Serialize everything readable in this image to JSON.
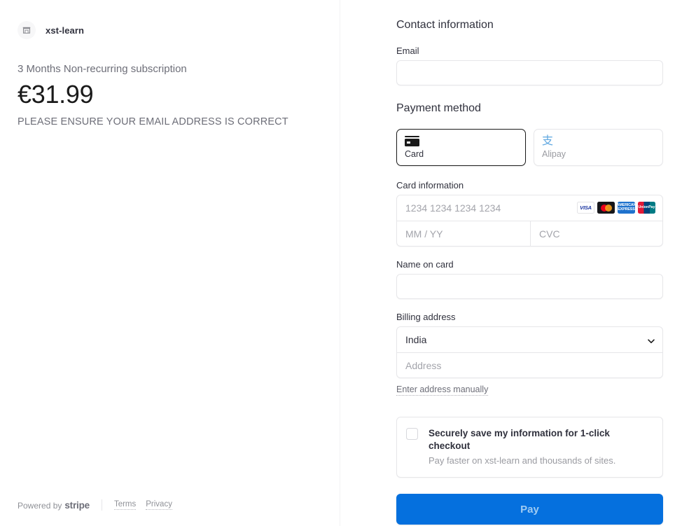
{
  "merchant": {
    "icon": "storefront-icon",
    "name": "xst-learn"
  },
  "summary": {
    "product": "3 Months Non-recurring subscription",
    "price": "€31.99",
    "notice": "PLEASE ENSURE YOUR EMAIL ADDRESS IS CORRECT"
  },
  "footer": {
    "powered_by": "Powered by",
    "stripe": "stripe",
    "terms": "Terms",
    "privacy": "Privacy"
  },
  "contact": {
    "section_title": "Contact information",
    "email_label": "Email",
    "email_value": "",
    "email_placeholder": ""
  },
  "payment_method": {
    "section_title": "Payment method",
    "tabs": [
      {
        "label": "Card",
        "icon": "credit-card-icon",
        "selected": true
      },
      {
        "label": "Alipay",
        "icon": "alipay-icon",
        "glyph": "支",
        "selected": false
      }
    ]
  },
  "card": {
    "section_label": "Card information",
    "number_placeholder": "1234 1234 1234 1234",
    "number_value": "",
    "expiry_placeholder": "MM / YY",
    "expiry_value": "",
    "cvc_placeholder": "CVC",
    "cvc_value": "",
    "brands": [
      {
        "name": "visa-icon",
        "text": "VISA"
      },
      {
        "name": "mastercard-icon",
        "text": ""
      },
      {
        "name": "amex-icon",
        "text": "AMERICAN EXPRESS"
      },
      {
        "name": "unionpay-icon",
        "text": "UnionPay"
      }
    ],
    "name_label": "Name on card",
    "name_value": "",
    "name_placeholder": ""
  },
  "billing": {
    "section_label": "Billing address",
    "country_value": "India",
    "address_placeholder": "Address",
    "address_value": "",
    "manual_link": "Enter address manually",
    "chevron": "chevron-down-icon"
  },
  "save_info": {
    "checked": false,
    "title": "Securely save my information for 1-click checkout",
    "subtitle": "Pay faster on xst-learn and thousands of sites."
  },
  "pay": {
    "label": "Pay"
  },
  "colors": {
    "accent": "#0570de",
    "pay_text": "#9fcbf2",
    "text_primary": "#30313d",
    "text_muted": "#6d6e78",
    "placeholder": "#a3a4ab",
    "border": "#e6e6e9",
    "alipay": "#5fa7e0"
  }
}
